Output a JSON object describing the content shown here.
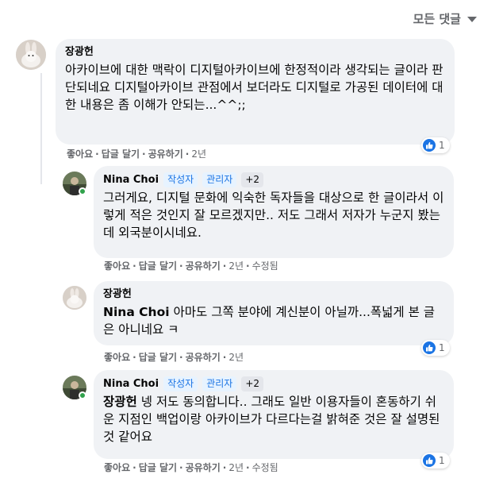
{
  "sort": {
    "label": "모든 댓글"
  },
  "colors": {
    "accent": "#1b74e4",
    "online": "#31a24c",
    "bubble": "#f0f2f5",
    "meta": "#65676b"
  },
  "comments": [
    {
      "author": "장광헌",
      "text": "아카이브에 대한 맥락이 디지털아카이브에 한정적이라 생각되는 글이라 판단되네요 디지털아카이브 관점에서 보더라도 디지털로 가공된 데이터에 대한 내용은 좀 이해가 안되는...^^;;",
      "actions": {
        "like": "좋아요",
        "reply": "답글 달기",
        "share": "공유하기",
        "time": "2년"
      },
      "reaction_count": "1"
    },
    {
      "author": "Nina Choi",
      "badges": [
        "작성자",
        "관리자",
        "+2"
      ],
      "text": "그러게요, 디지털 문화에 익숙한 독자들을 대상으로 한 글이라서 이렇게 적은 것인지 잘 모르겠지만.. 저도 그래서 저자가 누군지 봤는데 외국분이시네요.",
      "actions": {
        "like": "좋아요",
        "reply": "답글 달기",
        "share": "공유하기",
        "time": "2년",
        "edited": "수정됨"
      }
    },
    {
      "author": "장광헌",
      "mention": "Nina Choi",
      "text": " 아마도 그쪽 분야에 계신분이 아닐까...폭넓게 본 글은 아니네요 ㅋ",
      "actions": {
        "like": "좋아요",
        "reply": "답글 달기",
        "share": "공유하기",
        "time": "2년"
      },
      "reaction_count": "1"
    },
    {
      "author": "Nina Choi",
      "badges": [
        "작성자",
        "관리자",
        "+2"
      ],
      "mention": "장광헌",
      "text": " 넹 저도 동의합니다.. 그래도 일반 이용자들이 혼동하기 쉬운 지점인 백업이랑 아카이브가 다르다는걸 밝혀준 것은 잘 설명된것 같어요",
      "actions": {
        "like": "좋아요",
        "reply": "답글 달기",
        "share": "공유하기",
        "time": "2년",
        "edited": "수정됨"
      },
      "reaction_count": "1"
    }
  ]
}
